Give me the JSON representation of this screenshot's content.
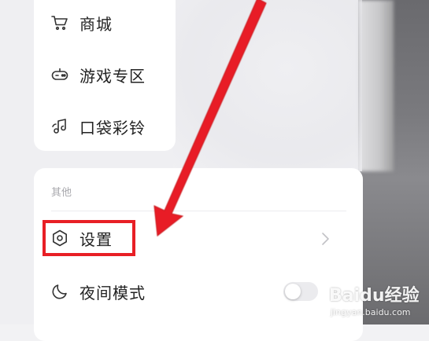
{
  "menu_top": {
    "items": [
      {
        "label": "商城",
        "icon": "cart-icon"
      },
      {
        "label": "游戏专区",
        "icon": "gamepad-icon"
      },
      {
        "label": "口袋彩铃",
        "icon": "music-note-icon"
      }
    ]
  },
  "other_section": {
    "title": "其他",
    "settings": {
      "label": "设置",
      "icon": "settings-icon"
    },
    "night_mode": {
      "label": "夜间模式",
      "icon": "moon-icon",
      "enabled": false
    }
  },
  "annotation": {
    "highlight_color": "#e81f25",
    "arrow_color": "#e81f25"
  },
  "watermark": {
    "main": "Baidu经验",
    "sub": "jingyan.baidu.com"
  }
}
